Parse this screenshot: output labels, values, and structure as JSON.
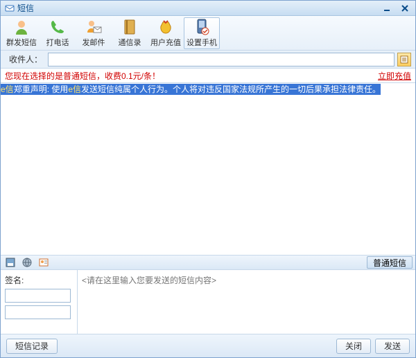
{
  "window": {
    "title": "短信"
  },
  "toolbar": {
    "items": [
      {
        "label": "群发短信"
      },
      {
        "label": "打电话"
      },
      {
        "label": "发邮件"
      },
      {
        "label": "通信录"
      },
      {
        "label": "用户充值"
      },
      {
        "label": "设置手机"
      }
    ]
  },
  "recipient": {
    "label": "收件人：",
    "value": ""
  },
  "status": {
    "text": "您现在选择的是普通短信，收费0.1元/条！",
    "link": "立即充值"
  },
  "notice": {
    "prefix": "e信",
    "mid1": "郑重声明: 使用",
    "mid2": "e信",
    "rest": "发送短信纯属个人行为。个人将对违反国家法规所产生的一切后果承担法律责任。"
  },
  "midbar": {
    "right_label": "普通短信"
  },
  "compose": {
    "sign_label": "签名:",
    "sign1": "",
    "sign2": "",
    "placeholder": "<请在这里输入您要发送的短信内容>"
  },
  "footer": {
    "history": "短信记录",
    "close": "关闭",
    "send": "发送"
  }
}
